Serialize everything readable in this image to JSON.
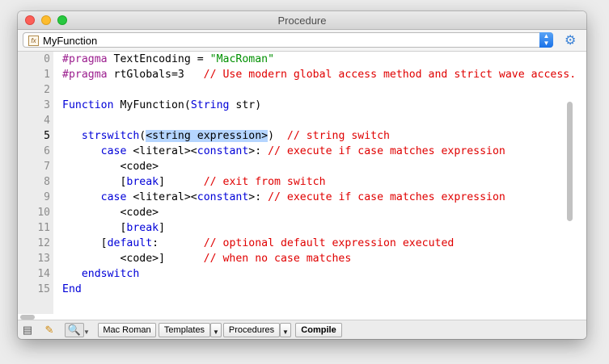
{
  "window": {
    "title": "Procedure"
  },
  "function_popup": {
    "selected": "MyFunction",
    "fx_icon": "fx-icon",
    "stepper": [
      "▲",
      "▼"
    ]
  },
  "line_numbers": [
    "0",
    "1",
    "2",
    "3",
    "4",
    "5",
    "6",
    "7",
    "8",
    "9",
    "10",
    "11",
    "12",
    "13",
    "14",
    "15"
  ],
  "code": {
    "l0_prag": "#pragma",
    "l0_rest": " TextEncoding = ",
    "l0_str": "\"MacRoman\"",
    "l1_prag": "#pragma",
    "l1_rest": " rtGlobals=3   ",
    "l1_cm": "// Use modern global access method and strict wave access.",
    "l3_kw": "Function",
    "l3_rest": " MyFunction(",
    "l3_kw2": "String",
    "l3_rest2": " str)",
    "l5_kw": "   strswitch",
    "l5_rest": "(",
    "l5_sel": "<string expression>",
    "l5_rest2": ")  ",
    "l5_cm": "// string switch",
    "l6_kw": "      case",
    "l6_rest": " <literal><",
    "l6_kw2": "constant",
    "l6_rest2": ">: ",
    "l6_cm": "// execute if case matches expression",
    "l7": "         <code>",
    "l8_rest": "         [",
    "l8_kw": "break",
    "l8_rest2": "]      ",
    "l8_cm": "// exit from switch",
    "l9_kw": "      case",
    "l9_rest": " <literal><",
    "l9_kw2": "constant",
    "l9_rest2": ">: ",
    "l9_cm": "// execute if case matches expression",
    "l10": "         <code>",
    "l11_rest": "         [",
    "l11_kw": "break",
    "l11_rest2": "]",
    "l12_rest": "      [",
    "l12_kw": "default",
    "l12_rest2": ":       ",
    "l12_cm": "// optional default expression executed",
    "l13_rest": "         <code>]      ",
    "l13_cm": "// when no case matches",
    "l14_kw": "   endswitch",
    "l15_kw": "End"
  },
  "bottom_bar": {
    "encoding": "Mac Roman",
    "templates": "Templates",
    "procedures": "Procedures",
    "compile": "Compile",
    "dropdown_glyph": "▼"
  },
  "icons": {
    "document": "document-icon",
    "pencil": "pencil-icon",
    "magnifier": "magnifier-icon",
    "gear": "gear-icon"
  },
  "colors": {
    "keyword": "#0000d8",
    "pragma": "#9b1d8e",
    "string": "#009000",
    "comment": "#e00000",
    "selection": "#b5d5ff"
  }
}
